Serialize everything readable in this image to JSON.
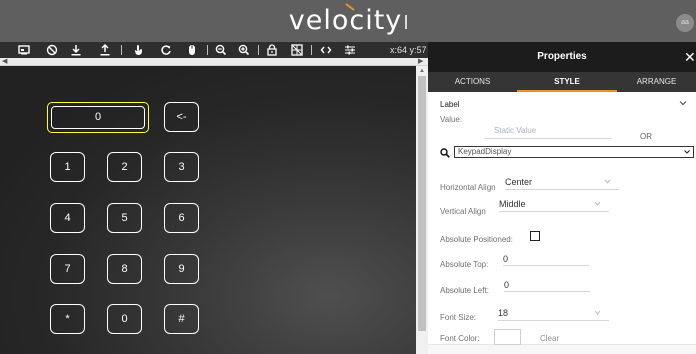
{
  "header": {
    "logo_text": "velocity",
    "avatar_text": "aa",
    "colors": {
      "header_bg": "#5f5f5f",
      "logo_accent": "#e8902a"
    }
  },
  "toolbar": {
    "icons": [
      "device-icon",
      "no-icon",
      "download-icon",
      "upload-icon",
      "touch-icon",
      "refresh-icon",
      "mouse-icon",
      "zoom-out-icon",
      "zoom-in-icon",
      "lock-icon",
      "grid-icon",
      "code-icon",
      "sliders-icon"
    ],
    "coordinates": "x:64 y:57"
  },
  "canvas": {
    "display_value": "0",
    "backspace_label": "<-",
    "keys": [
      {
        "label": "1"
      },
      {
        "label": "2"
      },
      {
        "label": "3"
      },
      {
        "label": "4"
      },
      {
        "label": "5"
      },
      {
        "label": "6"
      },
      {
        "label": "7"
      },
      {
        "label": "8"
      },
      {
        "label": "9"
      },
      {
        "label": "*"
      },
      {
        "label": "0"
      },
      {
        "label": "#"
      }
    ],
    "colors": {
      "selection_outline": "#ffff33",
      "key_outline": "#ffffff"
    }
  },
  "panel": {
    "title": "Properties",
    "close_glyph": "✕",
    "tabs": [
      {
        "label": "ACTIONS",
        "active": false
      },
      {
        "label": "STYLE",
        "active": true
      },
      {
        "label": "ARRANGE",
        "active": false
      }
    ],
    "section_label": "Label",
    "fields": {
      "value_label": "Value:",
      "value_placeholder": "Static Value",
      "or_label": "OR",
      "keypad_select": "KeypadDisplay",
      "h_align_label": "Horizontal Align",
      "h_align_value": "Center",
      "v_align_label": "Vertical Align",
      "v_align_value": "Middle",
      "abs_pos_label": "Absolute Positioned:",
      "abs_pos_checked": false,
      "abs_top_label": "Absolute Top:",
      "abs_top_value": "0",
      "abs_left_label": "Absolute Left:",
      "abs_left_value": "0",
      "font_size_label": "Font Size:",
      "font_size_value": "18",
      "font_color_label": "Font Color:",
      "font_color_value": "#ffffff",
      "clear_label": "Clear"
    },
    "colors": {
      "tab_accent": "#e8902a",
      "title_bg": "#1c1c1c"
    }
  }
}
